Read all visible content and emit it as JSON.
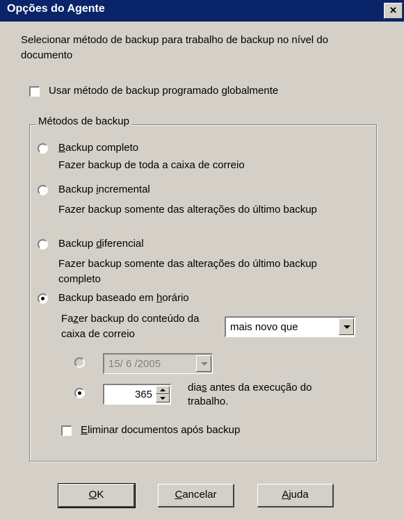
{
  "window": {
    "title": "Opções do Agente",
    "close_label": "×"
  },
  "description": "Selecionar método de backup para trabalho de backup no nível do documento",
  "global_checkbox": {
    "label": "Usar método de backup programado globalmente",
    "checked": false
  },
  "methods_group": {
    "legend": "Métodos de backup",
    "options": [
      {
        "label_pre": "",
        "accel": "B",
        "label_post": "ackup completo",
        "desc": "Fazer backup de toda a caixa de correio",
        "selected": false
      },
      {
        "label_pre": "Backup ",
        "accel": "i",
        "label_post": "ncremental",
        "desc": "Fazer backup somente das alterações do último backup",
        "selected": false
      },
      {
        "label_pre": "Backup ",
        "accel": "d",
        "label_post": "iferencial",
        "desc": "Fazer backup somente das alterações do último backup completo",
        "selected": false
      },
      {
        "label_pre": "Backup baseado em ",
        "accel": "h",
        "label_post": "orário",
        "selected": true
      }
    ],
    "content_label_pre": "Fa",
    "content_label_accel": "z",
    "content_label_post": "er backup do conteúdo da caixa de correio",
    "content_select_value": "mais novo que",
    "date_value": "15/ 6 /2005",
    "days_value": "365",
    "days_label_pre": "dia",
    "days_label_accel": "s",
    "days_label_post": " antes da execução do trabalho.",
    "delete_checkbox": {
      "label_accel": "E",
      "label_post": "liminar documentos após backup",
      "checked": false
    }
  },
  "buttons": {
    "ok_accel": "O",
    "ok_post": "K",
    "cancel_accel": "C",
    "cancel_post": "ancelar",
    "help_accel": "A",
    "help_post": "juda"
  }
}
